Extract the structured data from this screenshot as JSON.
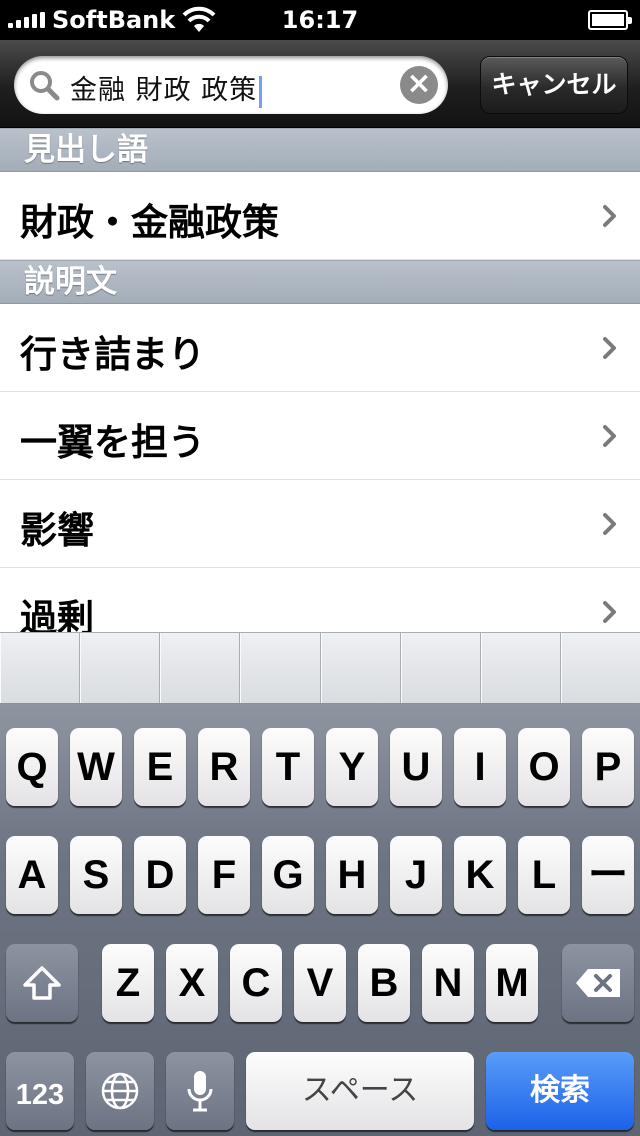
{
  "status_bar": {
    "carrier": "SoftBank",
    "time": "16:17"
  },
  "search": {
    "query": "金融 財政 政策",
    "cancel_label": "キャンセル"
  },
  "sections": [
    {
      "title": "見出し語",
      "items": [
        "財政・金融政策"
      ]
    },
    {
      "title": "説明文",
      "items": [
        "行き詰まり",
        "一翼を担う",
        "影響",
        "過剰"
      ]
    }
  ],
  "keyboard": {
    "row1": [
      "Q",
      "W",
      "E",
      "R",
      "T",
      "Y",
      "U",
      "I",
      "O",
      "P"
    ],
    "row2": [
      "A",
      "S",
      "D",
      "F",
      "G",
      "H",
      "J",
      "K",
      "L",
      "ー"
    ],
    "row3": [
      "Z",
      "X",
      "C",
      "V",
      "B",
      "N",
      "M"
    ],
    "numbers_label": "123",
    "space_label": "スペース",
    "search_label": "検索"
  },
  "colors": {
    "section_header": "#a7b1bc",
    "search_key": "#1c62e8",
    "caret": "#4a7ee6"
  }
}
